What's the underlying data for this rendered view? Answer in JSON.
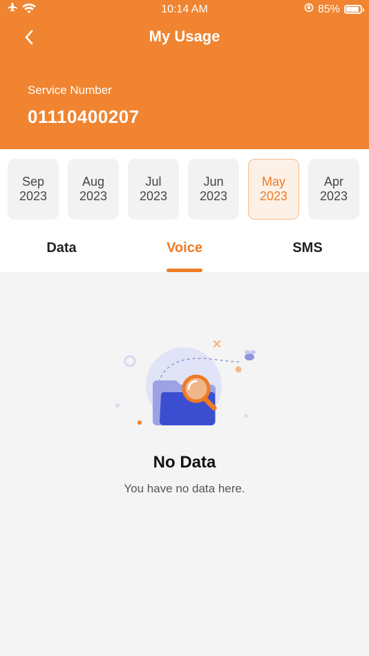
{
  "status_bar": {
    "time": "10:14 AM",
    "battery": "85%"
  },
  "header": {
    "title": "My Usage",
    "service_label": "Service Number",
    "service_number": "01110400207"
  },
  "months": [
    {
      "month": "Sep",
      "year": "2023"
    },
    {
      "month": "Aug",
      "year": "2023"
    },
    {
      "month": "Jul",
      "year": "2023"
    },
    {
      "month": "Jun",
      "year": "2023"
    },
    {
      "month": "May",
      "year": "2023"
    },
    {
      "month": "Apr",
      "year": "2023"
    }
  ],
  "selected_month_index": 4,
  "tabs": [
    "Data",
    "Voice",
    "SMS"
  ],
  "selected_tab_index": 1,
  "empty_state": {
    "title": "No Data",
    "subtitle": "You have no data here."
  },
  "colors": {
    "accent": "#f08430",
    "accent_text": "#ef7a22",
    "background": "#f4f4f4"
  }
}
